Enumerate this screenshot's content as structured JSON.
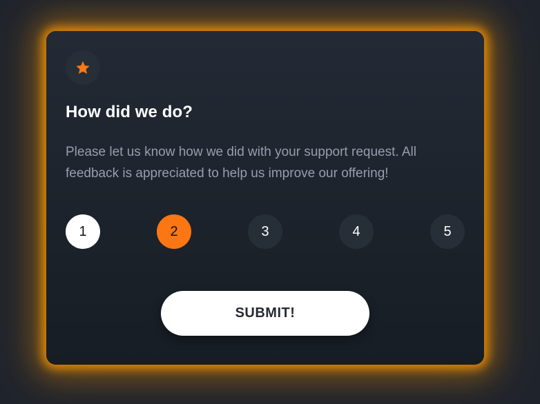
{
  "card": {
    "icon": "star-icon",
    "title": "How did we do?",
    "description": "Please let us know how we did with your support request. All feedback is appreciated to help us improve our offering!"
  },
  "ratings": {
    "options": [
      "1",
      "2",
      "3",
      "4",
      "5"
    ],
    "selected": "2",
    "hovered": "1"
  },
  "actions": {
    "submit_label": "SUBMIT!"
  },
  "colors": {
    "accent": "#fc7614",
    "glow": "#f39200",
    "card_bg": "#1f2630",
    "circle_bg": "#262e38",
    "text_primary": "#ffffff",
    "text_muted": "#969fad"
  }
}
